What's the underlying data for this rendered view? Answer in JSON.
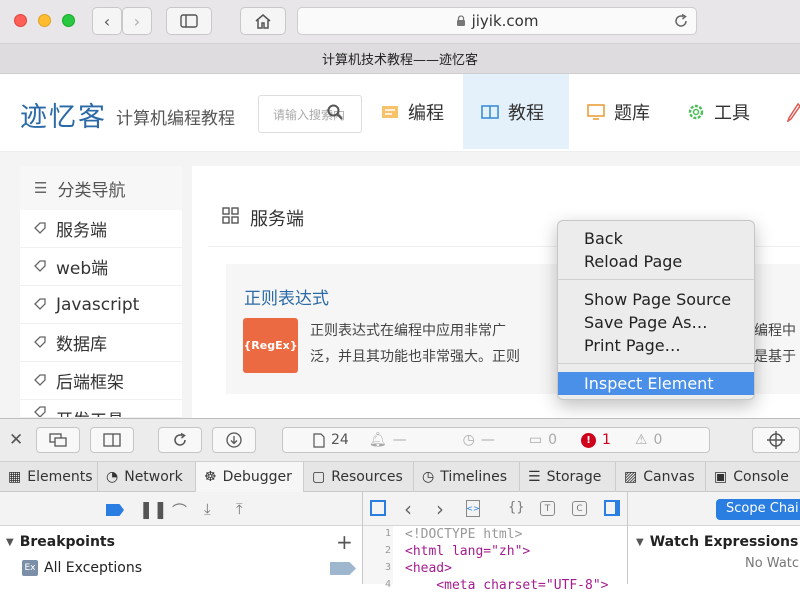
{
  "browser": {
    "url": "jiyik.com",
    "tab_title": "计算机技术教程——迹忆客"
  },
  "site": {
    "logo": "迹忆客",
    "slogan": "计算机编程教程",
    "search_placeholder": "请输入搜索内",
    "nav": [
      {
        "label": "编程",
        "icon": "code-editor-icon"
      },
      {
        "label": "教程",
        "icon": "book-icon"
      },
      {
        "label": "题库",
        "icon": "monitor-icon"
      },
      {
        "label": "工具",
        "icon": "gear-icon"
      }
    ],
    "sidebar_title": "分类导航",
    "sidebar_items": [
      "服务端",
      "web端",
      "Javascript",
      "数据库",
      "后端框架",
      "开发工具"
    ],
    "section_title": "服务端",
    "card": {
      "title": "正则表达式",
      "thumb_text": "{RegEx}",
      "desc_line1": "正则表达式在编程中应用非常广",
      "desc_line2": "泛，并且其功能也非常强大。正则",
      "right_line1": "在编程中",
      "right_line2": "也是基于"
    }
  },
  "context_menu": {
    "items": [
      "Back",
      "Reload Page",
      "Show Page Source",
      "Save Page As…",
      "Print Page…",
      "Inspect Element"
    ],
    "highlighted": "Inspect Element"
  },
  "devtools": {
    "resource_count": "24",
    "dash1": "—",
    "dash2": "—",
    "messages": "0",
    "errors": "1",
    "warnings": "0",
    "tabs": [
      "Elements",
      "Network",
      "Debugger",
      "Resources",
      "Timelines",
      "Storage",
      "Canvas",
      "Console"
    ],
    "selected_tab": "Debugger",
    "breakpoints_label": "Breakpoints",
    "all_exceptions": "All Exceptions",
    "code_lines": [
      {
        "n": "1",
        "text": "<!DOCTYPE html>"
      },
      {
        "n": "2",
        "text": "<html lang=\"zh\">"
      },
      {
        "n": "3",
        "text": "<head>"
      },
      {
        "n": "4",
        "text": "    <meta charset=\"UTF-8\">"
      }
    ],
    "scope_chain": "Scope Chai",
    "watch_expressions": "Watch Expressions",
    "no_watch": "No Watch"
  },
  "colors": {
    "accent": "#4a8fe8",
    "logo": "#2b6aa6",
    "error": "#d0021b"
  }
}
